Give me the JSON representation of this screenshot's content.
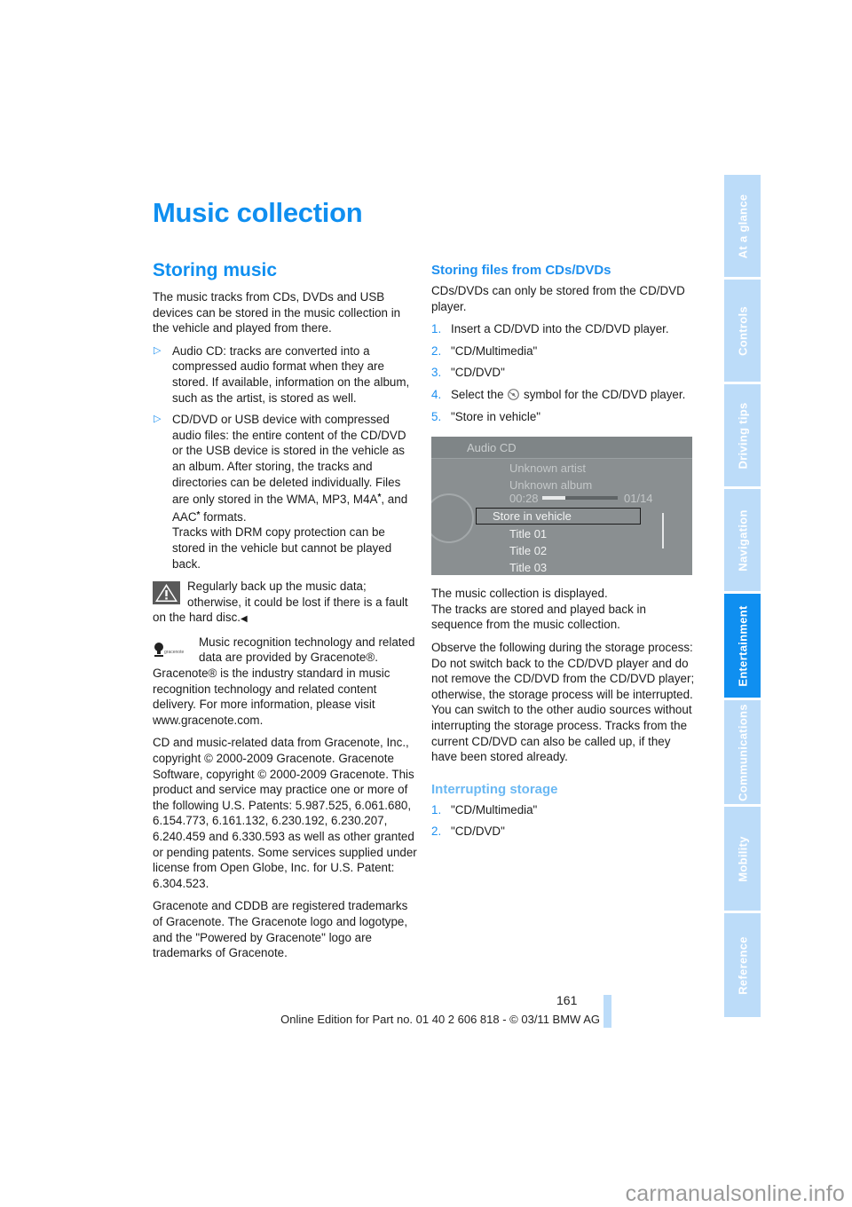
{
  "page": {
    "title": "Music collection",
    "number": "161",
    "footer": "Online Edition for Part no. 01 40 2 606 818 - © 03/11 BMW AG",
    "watermark": "carmanualsonline.info"
  },
  "side_tabs": [
    {
      "label": "At a glance",
      "active": false
    },
    {
      "label": "Controls",
      "active": false
    },
    {
      "label": "Driving tips",
      "active": false
    },
    {
      "label": "Navigation",
      "active": false
    },
    {
      "label": "Entertainment",
      "active": true
    },
    {
      "label": "Communications",
      "active": false
    },
    {
      "label": "Mobility",
      "active": false
    },
    {
      "label": "Reference",
      "active": false
    }
  ],
  "left": {
    "heading": "Storing music",
    "intro": "The music tracks from CDs, DVDs and USB devices can be stored in the music collection in the vehicle and played from there.",
    "bullets": [
      {
        "text": "Audio CD: tracks are converted into a compressed audio format when they are stored. If available, information on the album, such as the artist, is stored as well."
      },
      {
        "text_a": "CD/DVD or USB device with compressed audio files: the entire content of the CD/DVD or the USB device is stored in the vehicle as an album. After storing, the tracks and directories can be deleted individually. Files are only stored in the WMA, MP3, M4A",
        "star1": "*",
        "text_b": ", and AAC",
        "star2": "*",
        "text_c": " formats.",
        "text_d": "Tracks with DRM copy protection can be stored in the vehicle but cannot be played back."
      }
    ],
    "bullet_marker": "▷",
    "warning": "Regularly back up the music data; otherwise, it could be lost if there is a fault on the hard disc.",
    "end_marker": "◀",
    "gracenote_logo_text": "gracenote",
    "gracenote_note": "Music recognition technology and related data are provided by Gracenote®. Gracenote® is the industry standard in music recognition technology and related content delivery. For more information, please visit www.gracenote.com.",
    "copyright": "CD and music-related data from Gracenote, Inc., copyright © 2000-2009 Gracenote. Gracenote Software, copyright © 2000-2009 Gracenote. This product and service may practice one or more of the following U.S. Patents: 5.987.525, 6.061.680, 6.154.773, 6.161.132, 6.230.192, 6.230.207, 6.240.459 and 6.330.593 as well as other granted or pending patents. Some services supplied under license from Open Globe, Inc. for U.S. Patent: 6.304.523.",
    "trademarks": "Gracenote and CDDB are registered trademarks of Gracenote. The Gracenote logo and logotype, and the \"Powered by Gracenote\" logo are trademarks of Gracenote."
  },
  "right": {
    "heading": "Storing files from CDs/DVDs",
    "intro": "CDs/DVDs can only be stored from the CD/DVD player.",
    "steps": [
      {
        "num": "1.",
        "text": "Insert a CD/DVD into the CD/DVD player."
      },
      {
        "num": "2.",
        "text": "\"CD/Multimedia\""
      },
      {
        "num": "3.",
        "text": "\"CD/DVD\""
      },
      {
        "num": "4.",
        "text_a": "Select the ",
        "text_b": " symbol for the CD/DVD player."
      },
      {
        "num": "5.",
        "text": "\"Store in vehicle\""
      }
    ],
    "screen": {
      "header": "Audio CD",
      "artist": "Unknown artist",
      "album": "Unknown album",
      "elapsed": "00:28",
      "track": "01/14",
      "progress": 0.3,
      "selected": "Store in vehicle",
      "titles": [
        "Title 01",
        "Title 02",
        "Title 03"
      ]
    },
    "after_1": "The music collection is displayed.",
    "after_2": "The tracks are stored and played back in sequence from the music collection.",
    "observe_1": "Observe the following during the storage process:",
    "observe_2": "Do not switch back to the CD/DVD player and do not remove the CD/DVD from the CD/DVD player; otherwise, the storage process will be interrupted.",
    "observe_3": "You can switch to the other audio sources without interrupting the storage process. Tracks from the current CD/DVD can also be called up, if they have been stored already.",
    "subheading": "Interrupting storage",
    "interrupt_steps": [
      {
        "num": "1.",
        "text": "\"CD/Multimedia\""
      },
      {
        "num": "2.",
        "text": "\"CD/DVD\""
      }
    ]
  }
}
